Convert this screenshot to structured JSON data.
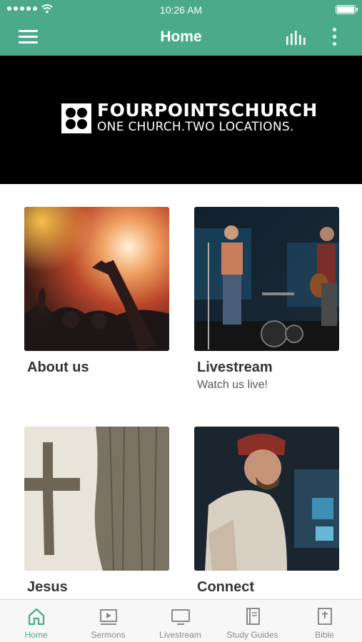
{
  "status_bar": {
    "time": "10:26 AM"
  },
  "header": {
    "title": "Home",
    "menu_icon": "hamburger-menu-icon",
    "audio_icon": "audio-bars-icon",
    "more_icon": "more-vertical-icon"
  },
  "banner": {
    "brand_name": "FOURPOINTSCHURCH",
    "tagline": "ONE CHURCH.TWO LOCATIONS."
  },
  "tiles": [
    {
      "title": "About us",
      "subtitle": ""
    },
    {
      "title": "Livestream",
      "subtitle": "Watch us live!"
    },
    {
      "title": "Jesus",
      "subtitle": ""
    },
    {
      "title": "Connect",
      "subtitle": ""
    }
  ],
  "tabbar": {
    "items": [
      {
        "label": "Home",
        "icon": "home-icon",
        "active": true
      },
      {
        "label": "Sermons",
        "icon": "video-play-icon",
        "active": false
      },
      {
        "label": "Livestream",
        "icon": "tv-icon",
        "active": false
      },
      {
        "label": "Study Guides",
        "icon": "book-icon",
        "active": false
      },
      {
        "label": "Bible",
        "icon": "bible-icon",
        "active": false
      }
    ]
  },
  "colors": {
    "accent": "#4aaa8a",
    "banner_bg": "#000000",
    "tab_inactive": "#8a8a8a"
  }
}
